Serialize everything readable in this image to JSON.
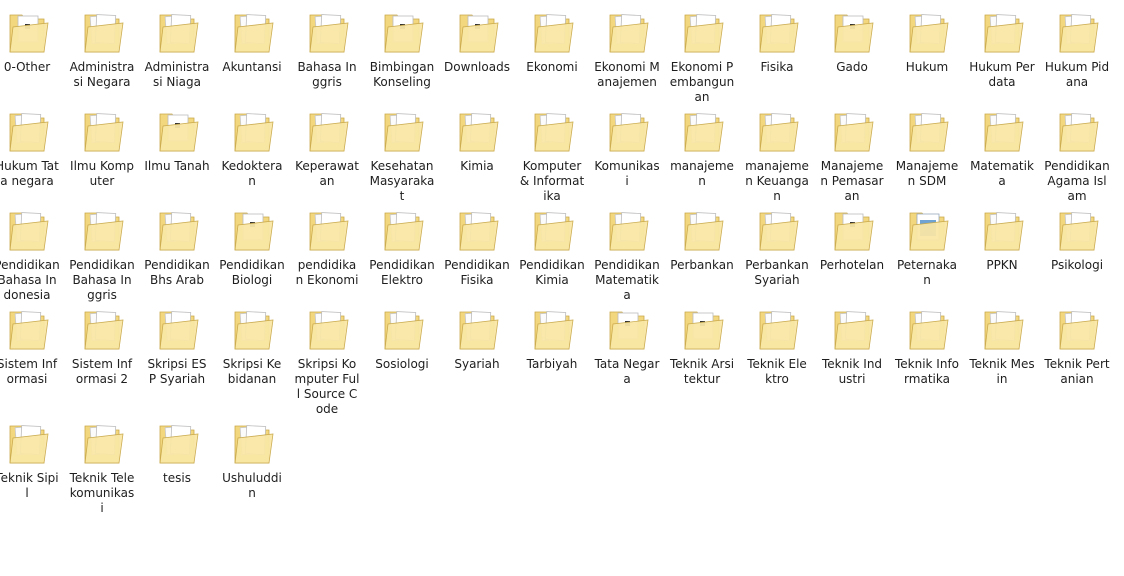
{
  "folder_icon": {
    "semantic": "folder-icon",
    "base_color": "#f3d77e",
    "front_color": "#f9e7a6",
    "edge_color": "#c9a94b"
  },
  "items": [
    {
      "label": "0-Other",
      "icon": "folder-icon",
      "content": "doc"
    },
    {
      "label": "Administrasi Negara",
      "icon": "folder-icon",
      "content": "papers"
    },
    {
      "label": "Administrasi Niaga",
      "icon": "folder-icon",
      "content": "papers"
    },
    {
      "label": "Akuntansi",
      "icon": "folder-icon",
      "content": "papers"
    },
    {
      "label": "Bahasa Inggris",
      "icon": "folder-icon",
      "content": "papers"
    },
    {
      "label": "Bimbingan Konseling",
      "icon": "folder-icon",
      "content": "doc"
    },
    {
      "label": "Downloads",
      "icon": "folder-icon",
      "content": "doc"
    },
    {
      "label": "Ekonomi",
      "icon": "folder-icon",
      "content": "papers"
    },
    {
      "label": "Ekonomi Manajemen",
      "icon": "folder-icon",
      "content": "papers"
    },
    {
      "label": "Ekonomi Pembangunan",
      "icon": "folder-icon",
      "content": "papers"
    },
    {
      "label": "Fisika",
      "icon": "folder-icon",
      "content": "papers"
    },
    {
      "label": "Gado",
      "icon": "folder-icon",
      "content": "doc"
    },
    {
      "label": "Hukum",
      "icon": "folder-icon",
      "content": "papers"
    },
    {
      "label": "Hukum Perdata",
      "icon": "folder-icon",
      "content": "papers"
    },
    {
      "label": "Hukum Pidana",
      "icon": "folder-icon",
      "content": "papers"
    },
    {
      "label": "Hukum Tata negara",
      "icon": "folder-icon",
      "content": "papers"
    },
    {
      "label": "Ilmu Komputer",
      "icon": "folder-icon",
      "content": "papers"
    },
    {
      "label": "Ilmu Tanah",
      "icon": "folder-icon",
      "content": "doc"
    },
    {
      "label": "Kedokteran",
      "icon": "folder-icon",
      "content": "papers"
    },
    {
      "label": "Keperawatan",
      "icon": "folder-icon",
      "content": "papers"
    },
    {
      "label": "Kesehatan Masyarakat",
      "icon": "folder-icon",
      "content": "papers"
    },
    {
      "label": "Kimia",
      "icon": "folder-icon",
      "content": "papers"
    },
    {
      "label": "Komputer & Informatika",
      "icon": "folder-icon",
      "content": "papers"
    },
    {
      "label": "Komunikasi",
      "icon": "folder-icon",
      "content": "papers"
    },
    {
      "label": "manajemen",
      "icon": "folder-icon",
      "content": "papers"
    },
    {
      "label": "manajemen Keuangan",
      "icon": "folder-icon",
      "content": "papers"
    },
    {
      "label": "Manajemen Pemasaran",
      "icon": "folder-icon",
      "content": "papers"
    },
    {
      "label": "Manajemen SDM",
      "icon": "folder-icon",
      "content": "papers"
    },
    {
      "label": "Matematika",
      "icon": "folder-icon",
      "content": "papers"
    },
    {
      "label": "Pendidikan Agama Islam",
      "icon": "folder-icon",
      "content": "papers"
    },
    {
      "label": "Pendidikan Bahasa Indonesia",
      "icon": "folder-icon",
      "content": "papers"
    },
    {
      "label": "Pendidikan Bahasa Inggris",
      "icon": "folder-icon",
      "content": "papers"
    },
    {
      "label": "Pendidikan Bhs Arab",
      "icon": "folder-icon",
      "content": "papers"
    },
    {
      "label": "Pendidikan Biologi",
      "icon": "folder-icon",
      "content": "doc"
    },
    {
      "label": "pendidikan Ekonomi",
      "icon": "folder-icon",
      "content": "papers"
    },
    {
      "label": "Pendidikan Elektro",
      "icon": "folder-icon",
      "content": "papers"
    },
    {
      "label": "Pendidikan Fisika",
      "icon": "folder-icon",
      "content": "papers"
    },
    {
      "label": "Pendidikan Kimia",
      "icon": "folder-icon",
      "content": "papers"
    },
    {
      "label": "Pendidikan Matematika",
      "icon": "folder-icon",
      "content": "papers"
    },
    {
      "label": "Perbankan",
      "icon": "folder-icon",
      "content": "papers"
    },
    {
      "label": "Perbankan Syariah",
      "icon": "folder-icon",
      "content": "papers"
    },
    {
      "label": "Perhotelan",
      "icon": "folder-icon",
      "content": "doc"
    },
    {
      "label": "Peternakan",
      "icon": "folder-icon",
      "content": "image"
    },
    {
      "label": "PPKN",
      "icon": "folder-icon",
      "content": "papers"
    },
    {
      "label": "Psikologi",
      "icon": "folder-icon",
      "content": "papers"
    },
    {
      "label": "Sistem Informasi",
      "icon": "folder-icon",
      "content": "papers"
    },
    {
      "label": "Sistem Informasi 2",
      "icon": "folder-icon",
      "content": "papers"
    },
    {
      "label": "Skripsi ESP Syariah",
      "icon": "folder-icon",
      "content": "papers"
    },
    {
      "label": "Skripsi Kebidanan",
      "icon": "folder-icon",
      "content": "papers"
    },
    {
      "label": "Skripsi Komputer Full Source Code",
      "icon": "folder-icon",
      "content": "papers"
    },
    {
      "label": "Sosiologi",
      "icon": "folder-icon",
      "content": "papers"
    },
    {
      "label": "Syariah",
      "icon": "folder-icon",
      "content": "papers"
    },
    {
      "label": "Tarbiyah",
      "icon": "folder-icon",
      "content": "papers"
    },
    {
      "label": "Tata Negara",
      "icon": "folder-icon",
      "content": "doc"
    },
    {
      "label": "Teknik Arsitektur",
      "icon": "folder-icon",
      "content": "doc"
    },
    {
      "label": "Teknik Elektro",
      "icon": "folder-icon",
      "content": "papers"
    },
    {
      "label": "Teknik Industri",
      "icon": "folder-icon",
      "content": "papers"
    },
    {
      "label": "Teknik Informatika",
      "icon": "folder-icon",
      "content": "papers"
    },
    {
      "label": "Teknik Mesin",
      "icon": "folder-icon",
      "content": "papers"
    },
    {
      "label": "Teknik Pertanian",
      "icon": "folder-icon",
      "content": "papers"
    },
    {
      "label": "Teknik Sipil",
      "icon": "folder-icon",
      "content": "papers"
    },
    {
      "label": "Teknik Telekomunikasi",
      "icon": "folder-icon",
      "content": "papers"
    },
    {
      "label": "tesis",
      "icon": "folder-icon",
      "content": "papers"
    },
    {
      "label": "Ushuluddin",
      "icon": "folder-icon",
      "content": "papers"
    }
  ]
}
